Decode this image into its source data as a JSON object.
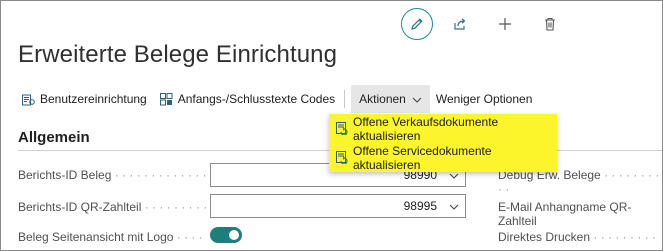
{
  "page": {
    "title": "Erweiterte Belege Einrichtung"
  },
  "top_actions": [
    {
      "icon": "pencil-icon"
    },
    {
      "icon": "share-icon"
    },
    {
      "icon": "plus-icon"
    },
    {
      "icon": "trash-icon"
    }
  ],
  "actionbar": {
    "user_setup_label": "Benutzereinrichtung",
    "codes_label": "Anfangs-/Schlusstexte Codes",
    "actions_label": "Aktionen",
    "fewer_options_label": "Weniger Optionen"
  },
  "dropdown": {
    "items": [
      {
        "label": "Offene Verkaufsdokumente aktualisieren",
        "icon": "update-document-icon"
      },
      {
        "label": "Offene Servicedokumente aktualisieren",
        "icon": "update-document-icon"
      }
    ],
    "highlight_color": "#fcf52b"
  },
  "section": {
    "title": "Allgemein"
  },
  "fields": {
    "berichts_id_beleg": {
      "label": "Berichts-ID Beleg",
      "value": "98990"
    },
    "berichts_id_qr": {
      "label": "Berichts-ID QR-Zahlteil",
      "value": "98995"
    },
    "seitenansicht_logo": {
      "label": "Beleg Seitenansicht mit Logo",
      "checked": true
    }
  },
  "right_fields": {
    "debug": {
      "label": "Debug Erw. Belege"
    },
    "email_anhang": {
      "label": "E-Mail Anhangname QR-Zahlteil"
    },
    "direktes_drucken": {
      "label": "Direktes Drucken"
    }
  },
  "colors": {
    "accent": "#1b7f7c"
  }
}
